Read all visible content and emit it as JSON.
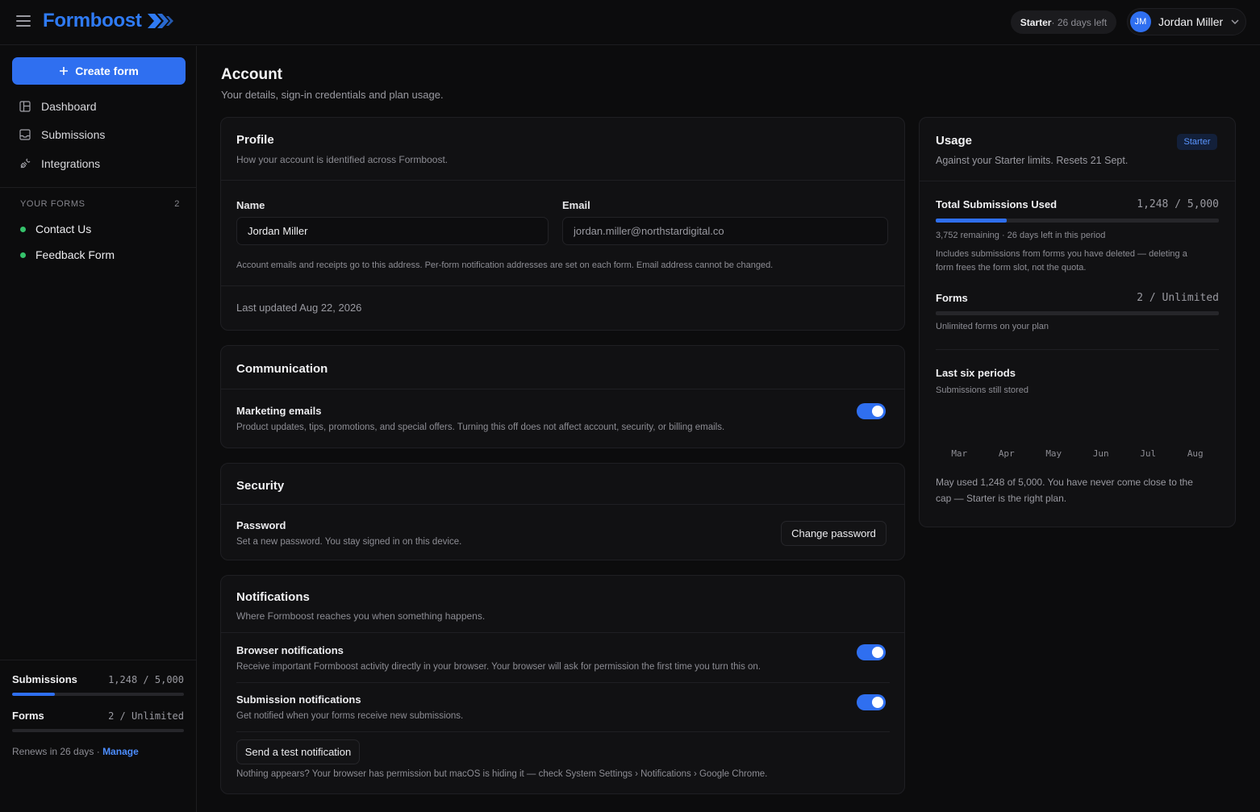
{
  "app": {
    "brand": "Formboost",
    "plan_name": "Starter",
    "plan_days": " · 26 days left",
    "user_initials": "JM",
    "user_name": "Jordan Miller"
  },
  "sidebar": {
    "create_label": "Create form",
    "nav": [
      {
        "label": "Dashboard",
        "icon": "dashboard-icon"
      },
      {
        "label": "Submissions",
        "icon": "inbox-icon"
      },
      {
        "label": "Integrations",
        "icon": "plug-icon"
      }
    ],
    "your_forms_label": "YOUR FORMS",
    "your_forms_count": "2",
    "forms": [
      {
        "name": "Contact Us",
        "status_color": "#35c26b"
      },
      {
        "name": "Feedback Form",
        "status_color": "#35c26b"
      }
    ],
    "stats": {
      "submissions_label": "Submissions",
      "submissions_value": "1,248 / 5,000",
      "submissions_fraction": 0.2496,
      "forms_label": "Forms",
      "forms_value": "2 / Unlimited",
      "renews_text": "Renews in 26 days · ",
      "manage_label": "Manage"
    }
  },
  "page": {
    "title": "Account",
    "subtitle": "Your details, sign-in credentials and plan usage."
  },
  "profile": {
    "title": "Profile",
    "subtitle": "How your account is identified across Formboost.",
    "name_label": "Name",
    "name_value": "Jordan Miller",
    "email_label": "Email",
    "email_value": "jordan.miller@northstardigital.co",
    "note": "Account emails and receipts go to this address. Per-form notification addresses are set on each form. Email address cannot be changed.",
    "last_updated": "Last updated Aug 22, 2026"
  },
  "communication": {
    "title": "Communication",
    "marketing_title": "Marketing emails",
    "marketing_desc": "Product updates, tips, promotions, and special offers. Turning this off does not affect account, security, or billing emails.",
    "marketing_on": true
  },
  "security": {
    "title": "Security",
    "password_title": "Password",
    "password_desc": "Set a new password. You stay signed in on this device.",
    "change_label": "Change password"
  },
  "notifications": {
    "title": "Notifications",
    "subtitle": "Where Formboost reaches you when something happens.",
    "browser_title": "Browser notifications",
    "browser_desc": "Receive important Formboost activity directly in your browser. Your browser will ask for permission the first time you turn this on.",
    "submission_title": "Submission notifications",
    "submission_desc": "Get notified when your forms receive new submissions.",
    "test_label": "Send a test notification",
    "help": "Nothing appears? Your browser has permission but macOS is hiding it — check System Settings › Notifications › Google Chrome."
  },
  "usage": {
    "title": "Usage",
    "badge": "Starter",
    "subtitle": "Against your Starter limits. Resets 21 Sept.",
    "total_label": "Total Submissions Used",
    "total_value": "1,248 / 5,000",
    "total_fraction": 0.2496,
    "remaining": "3,752 remaining · 26 days left in this period",
    "includes_note": "Includes submissions from forms you have deleted — deleting a form frees the form slot, not the quota.",
    "forms_label": "Forms",
    "forms_value": "2 / Unlimited",
    "forms_note": "Unlimited forms on your plan",
    "periods_title": "Last six periods",
    "periods_sub": "Submissions still stored",
    "months": [
      "Mar",
      "Apr",
      "May",
      "Jun",
      "Jul",
      "Aug"
    ],
    "footer": "May used 1,248 of 5,000. You have never come close to the cap — Starter is the right plan."
  },
  "colors": {
    "accent": "#2f6ff0",
    "brand": "#2f7bf5",
    "status_green": "#35c26b",
    "background": "#0c0c0d"
  }
}
